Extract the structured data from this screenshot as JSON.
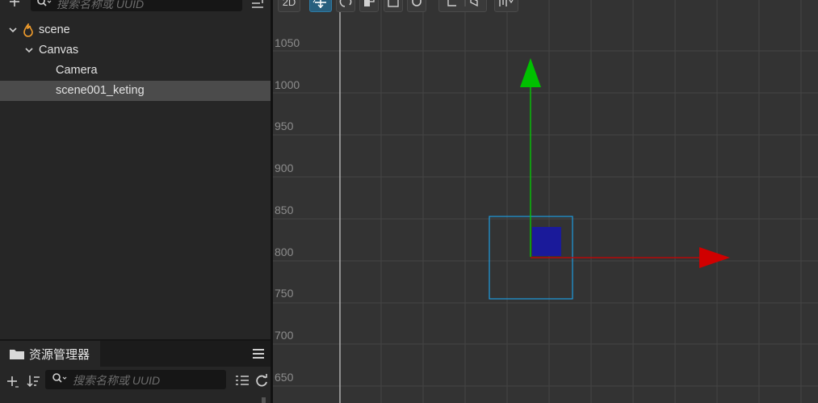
{
  "hierarchy": {
    "search_placeholder": "搜索名称或 UUID",
    "nodes": [
      {
        "label": "scene",
        "expanded": true,
        "icon": "fire-icon"
      },
      {
        "label": "Canvas",
        "expanded": true
      },
      {
        "label": "Camera"
      },
      {
        "label": "scene001_keting",
        "selected": true
      }
    ]
  },
  "assets": {
    "tab_label": "资源管理器",
    "search_placeholder": "搜索名称或 UUID"
  },
  "scene": {
    "toolbar": {
      "mode_label": "2D"
    },
    "y_axis_labels": [
      "1050",
      "1000",
      "950",
      "900",
      "850",
      "800",
      "750",
      "700",
      "650"
    ],
    "colors": {
      "background": "#333333",
      "grid": "#444444",
      "y_gizmo": "#00d000",
      "x_gizmo": "#d00000",
      "selection_box": "#1e9ce0",
      "node_fill": "#1a1a9a"
    }
  }
}
